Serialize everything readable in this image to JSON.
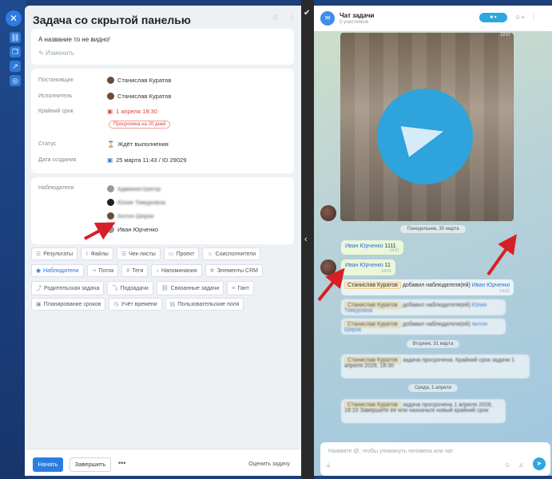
{
  "sidebar": {
    "close_icon": "close-icon"
  },
  "task": {
    "title": "Задача со скрытой панелью",
    "description": "А название то не видно!",
    "edit_label": "Изменить",
    "fields": {
      "creator_label": "Постановщик",
      "creator_value": "Станислав Куратов",
      "assignee_label": "Исполнитель",
      "assignee_value": "Станислав Куратов",
      "deadline_label": "Крайний срок",
      "deadline_value": "1 апреля 18:30",
      "overdue_badge": "Просрочена на 20 дней",
      "status_label": "Статус",
      "status_value": "Ждёт выполнения",
      "created_label": "Дата создания",
      "created_value": "25 марта 11:43 / ID 29029"
    },
    "observers_label": "Наблюдатели",
    "observers": [
      "Администратор",
      "Юлия Тимуровна",
      "Антон Широк",
      "Иван Юрченко"
    ],
    "tags_row1": [
      "Результаты",
      "Файлы",
      "Чек-листы",
      "Проект",
      "Соисполнители"
    ],
    "tags_row2": [
      "Наблюдатели",
      "Поток",
      "Теги",
      "Напоминания",
      "Элементы CRM"
    ],
    "tags_row3": [
      "Родительская задача",
      "Подзадачи",
      "Связанные задачи",
      "Гант"
    ],
    "tags_row4": [
      "Планирование сроков",
      "Учёт времени",
      "Пользовательские поля"
    ],
    "start_button": "Начать",
    "complete_button": "Завершить",
    "more_button": "•••",
    "rate_button": "Оценить задачу"
  },
  "chat": {
    "title": "Чат задачи",
    "subtitle": "5 участников",
    "image_time": "12:57",
    "date1": "Понедельник, 30 марта",
    "msg1_name": "Иван Юрченко",
    "msg1_text": "1111",
    "msg1_time": "14:01",
    "msg2_name": "Иван Юрченко",
    "msg2_text": "11",
    "msg2_time": "14:01",
    "sys1_who": "Станислав Куратов",
    "sys1_text": "добавил наблюдателя(ей)",
    "sys1_link": "Иван Юрченко",
    "sys1_time": "14:01",
    "sys2_who": "Станислав Куратов",
    "sys2_text": "добавил наблюдателя(ей)",
    "sys2_link": "Юлия Тимуровна",
    "sys3_who": "Станислав Куратов",
    "sys3_text": "добавил наблюдателя(ей)",
    "sys3_link": "Антон Широк",
    "date2": "Вторник, 31 марта",
    "sys4_who": "Станислав Куратов",
    "sys4_text": "задача просрочена. Крайний срок задачи 1 апреля 2026, 18:30",
    "date3": "Среда, 1 апреля",
    "sys5_who": "Станислав Куратов",
    "sys5_text": "задача просрочена 1 апреля 2026, 18:10 Завершите ее или назначьте новый крайний срок",
    "input_placeholder": "Нажмите @, чтобы упомянуть человека или чат"
  },
  "colors": {
    "accent": "#2d7de0",
    "overdue": "#e0403a",
    "annotation_arrow": "#d61f26"
  }
}
